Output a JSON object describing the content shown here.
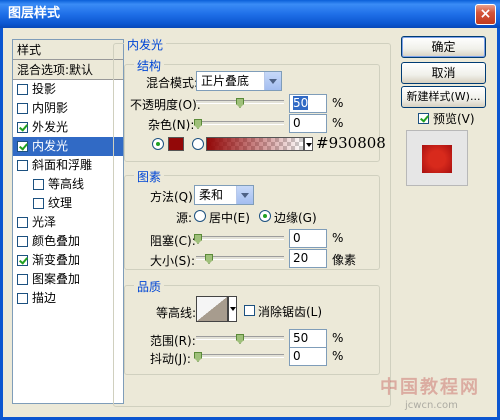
{
  "window": {
    "title": "图层样式",
    "close_label": "×"
  },
  "left_panel": {
    "header": "样式",
    "blend_item": "混合选项:默认",
    "items": [
      {
        "label": "投影",
        "checked": false
      },
      {
        "label": "内阴影",
        "checked": false
      },
      {
        "label": "外发光",
        "checked": true
      },
      {
        "label": "内发光",
        "checked": true,
        "selected": true
      },
      {
        "label": "斜面和浮雕",
        "checked": false
      },
      {
        "label": "等高线",
        "checked": false,
        "indent": true
      },
      {
        "label": "纹理",
        "checked": false,
        "indent": true
      },
      {
        "label": "光泽",
        "checked": false
      },
      {
        "label": "颜色叠加",
        "checked": false
      },
      {
        "label": "渐变叠加",
        "checked": true
      },
      {
        "label": "图案叠加",
        "checked": false
      },
      {
        "label": "描边",
        "checked": false
      }
    ]
  },
  "panel": {
    "title": "内发光",
    "structure": {
      "title": "结构",
      "blend_mode_label": "混合模式:",
      "blend_mode_value": "正片叠底",
      "opacity_label": "不透明度(O):",
      "opacity_value": "50",
      "opacity_unit": "%",
      "noise_label": "杂色(N):",
      "noise_value": "0",
      "noise_unit": "%",
      "color_hex": "#930808"
    },
    "elements": {
      "title": "图素",
      "method_label": "方法(Q):",
      "method_value": "柔和",
      "source_label": "源:",
      "source_center": "居中(E)",
      "source_edge": "边缘(G)",
      "choke_label": "阻塞(C):",
      "choke_value": "0",
      "choke_unit": "%",
      "size_label": "大小(S):",
      "size_value": "20",
      "size_unit": "像素"
    },
    "quality": {
      "title": "品质",
      "contour_label": "等高线:",
      "antialias_label": "消除锯齿(L)",
      "range_label": "范围(R):",
      "range_value": "50",
      "range_unit": "%",
      "jitter_label": "抖动(J):",
      "jitter_value": "0",
      "jitter_unit": "%"
    }
  },
  "buttons": {
    "ok": "确定",
    "cancel": "取消",
    "new_style": "新建样式(W)...",
    "preview_label": "预览(V)"
  },
  "watermark": {
    "main": "中国教程网",
    "url": "jcwcn.com"
  },
  "colors": {
    "glow": "#930808",
    "accent": "#316AC5"
  }
}
